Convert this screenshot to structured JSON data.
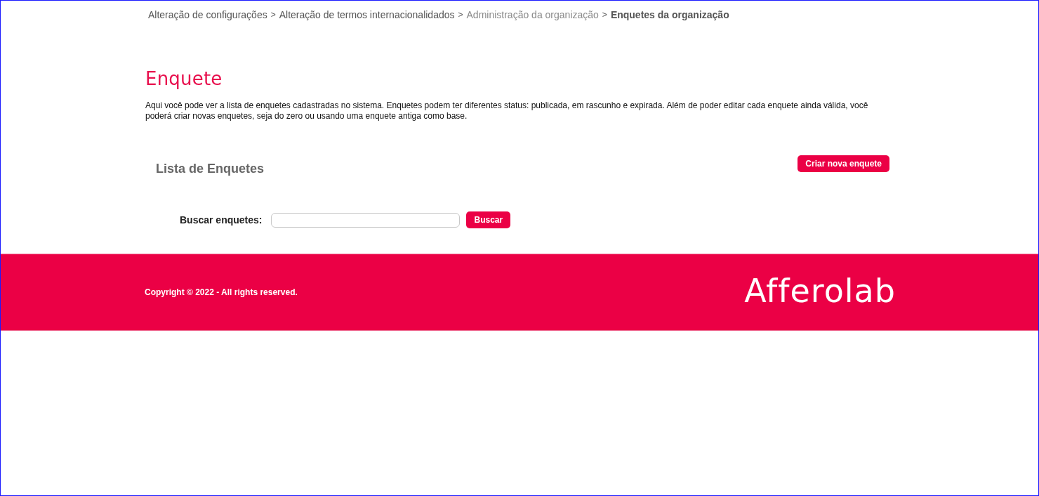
{
  "breadcrumb": [
    {
      "label": "Alteração de configurações",
      "kind": "link",
      "separator": ">"
    },
    {
      "label": "Alteração de termos internacionalidados",
      "kind": "link",
      "separator": ">"
    },
    {
      "label": "Administração da organização",
      "kind": "visited",
      "separator": ">"
    },
    {
      "label": "Enquetes da organização",
      "kind": "current"
    }
  ],
  "page": {
    "title": "Enquete",
    "description": "Aqui você pode ver a lista de enquetes cadastradas no sistema. Enquetes podem ter diferentes status: publicada, em rascunho e expirada. Além de poder editar cada enquete ainda válida, você poderá criar novas enquetes, seja do zero ou usando uma enquete antiga como base."
  },
  "poll_list": {
    "title": "Lista de Enquetes",
    "create_button": "Criar nova enquete",
    "search": {
      "label": "Buscar enquetes:",
      "button": "Buscar"
    }
  },
  "footer": {
    "copyright": "Copyright © 2022 - All rights reserved.",
    "logo_text": "Afferolab"
  }
}
